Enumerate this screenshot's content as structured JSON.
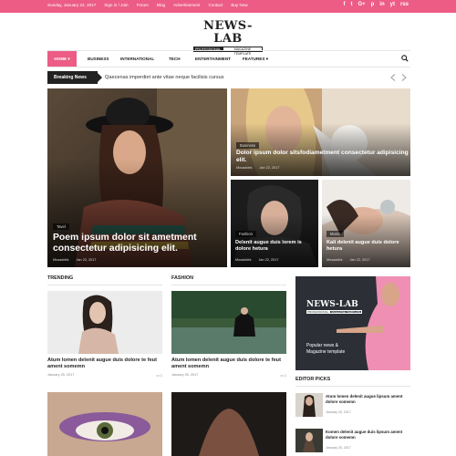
{
  "topbar": {
    "date": "Sunday, January 22, 2017",
    "links": [
      "Sign in / Join",
      "Forum",
      "Blog",
      "Advertisement",
      "Contact",
      "Buy Now"
    ],
    "social": [
      "f",
      "t",
      "G+",
      "p",
      "in",
      "yt",
      "rss"
    ]
  },
  "logo": {
    "name": "NEWS-LAB",
    "tag_a": "PROFESSIONAL",
    "tag_b": "MAGAZINE TEMPLATE"
  },
  "nav": {
    "items": [
      "HOME",
      "BUSINESS",
      "INTERNATIONAL",
      "TECH",
      "ENTERTAINMENT",
      "FEATURES"
    ]
  },
  "breaking": {
    "label": "Breaking News",
    "text": "Qaecenas imperdiet ante vitae neque facilisis cursus"
  },
  "hero": {
    "main": {
      "category": "Tavel",
      "title": "Poem ipsum dolor sit ametment consectetur adipisicing elit.",
      "author": "Mosaddek",
      "date": "Jan 22, 2017"
    },
    "top_right": {
      "category": "Business",
      "title": "Dolor ipsum dolor sitsfodiametment consectetur adipisicing elit.",
      "author": "Mosaddek",
      "date": "Jan 22, 2017"
    },
    "bottom_left": {
      "category": "Fashion",
      "title": "Delenit augue duis lorem is dolore hetura",
      "author": "Mosaddek",
      "date": "Jan 22, 2017"
    },
    "bottom_right": {
      "category": "Music",
      "title": "Kali delenit augue duis dolore hetura",
      "author": "Mosaddek",
      "date": "Jan 22, 2017"
    }
  },
  "trending": {
    "heading": "TRENDING",
    "post": {
      "title": "Atum lomen delenit augue duis dolore te feut ament somemn",
      "date": "January 25, 2017",
      "comments": "1"
    }
  },
  "fashion": {
    "heading": "FASHION",
    "post": {
      "title": "Atum lomen delenit augue duis dolore te feut ament somemn",
      "date": "January 25, 2017",
      "comments": "1"
    }
  },
  "ad": {
    "name": "NEWS-LAB",
    "tag_a": "PROFESSIONAL",
    "tag_b": "MAGAZINE TEMPLATE",
    "line1": "Popular news &",
    "line2": "Magazine template"
  },
  "editor_picks": {
    "heading": "EDITOR PICKS",
    "items": [
      {
        "title": "Atum lomen delenit augue lipsum ament dolore somemn",
        "date": "January 25, 2017"
      },
      {
        "title": "Komen delenit augue duis lipsum ament dolore somemn",
        "date": "January 25, 2017"
      }
    ]
  },
  "colors": {
    "accent": "#ec5c85",
    "dark": "#222222"
  }
}
